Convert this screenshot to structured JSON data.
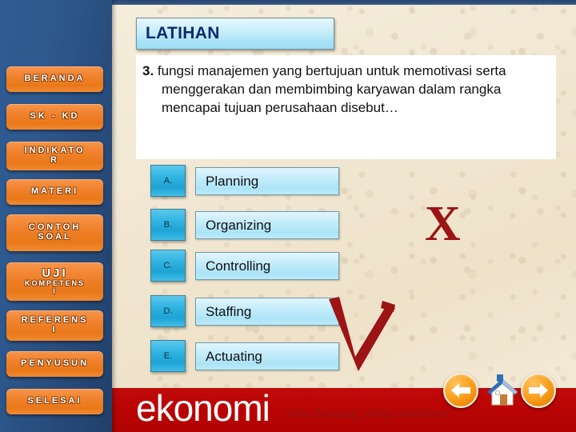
{
  "slide": {
    "title": "LATIHAN",
    "question_number": "3.",
    "question_text": "fungsi manajemen yang bertujuan untuk memotivasi serta menggerakan dan membimbing karyawan dalam rangka mencapai tujuan perusahaan disebut…"
  },
  "sidebar": {
    "items": [
      {
        "label": "BERANDA",
        "sub": ""
      },
      {
        "label": "SK - KD",
        "sub": ""
      },
      {
        "label": "INDIKATO\nR",
        "sub": ""
      },
      {
        "label": "MATERI",
        "sub": ""
      },
      {
        "label": "CONTOH\nSOAL",
        "sub": ""
      },
      {
        "label": "UJI",
        "sub": "KOMPETENS\nI"
      },
      {
        "label": "REFERENS\nI",
        "sub": ""
      },
      {
        "label": "PENYUSUN",
        "sub": ""
      },
      {
        "label": "SELESAI",
        "sub": ""
      }
    ]
  },
  "options": [
    {
      "letter": "A.",
      "text": "Planning"
    },
    {
      "letter": "B.",
      "text": "Organizing"
    },
    {
      "letter": "C.",
      "text": "Controlling"
    },
    {
      "letter": "D.",
      "text": "Staffing"
    },
    {
      "letter": "E.",
      "text": "Actuating"
    }
  ],
  "marks": {
    "wrong_symbol": "X",
    "correct_symbol": "✓"
  },
  "footer": {
    "brand": "ekonomi",
    "tagline": "Rela Berbagi, Ikhlas Memberi"
  },
  "nav": {
    "back_icon": "arrow-left-icon",
    "home_icon": "home-icon",
    "next_icon": "arrow-right-icon"
  },
  "colors": {
    "sidebar_blue": "#2e598e",
    "button_orange": "#f0812c",
    "footer_red": "#bb0505",
    "title_blue": "#0c2a6e",
    "mark_red": "#9c1414",
    "option_cyan": "#33b5e2"
  }
}
